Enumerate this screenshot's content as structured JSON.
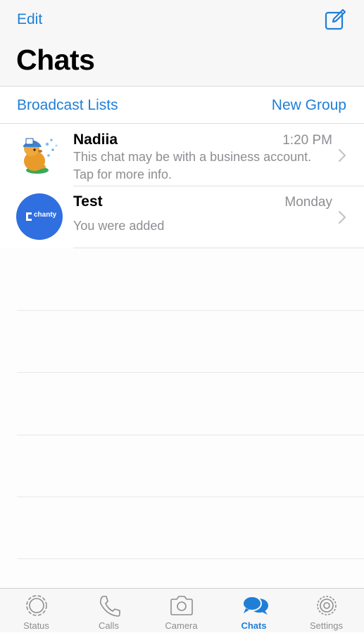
{
  "header": {
    "edit_label": "Edit",
    "title": "Chats",
    "compose_icon": "compose-icon"
  },
  "subbar": {
    "broadcast_label": "Broadcast Lists",
    "new_group_label": "New Group"
  },
  "chats": [
    {
      "name": "Nadiia",
      "time": "1:20 PM",
      "preview": "This chat may be with a business account. Tap for more info.",
      "avatar_icon": "beaver-sticker-avatar"
    },
    {
      "name": "Test",
      "time": "Monday",
      "preview": "You were added",
      "avatar_text": "chanty",
      "avatar_color": "#2f6fe0"
    }
  ],
  "tabs": [
    {
      "label": "Status",
      "icon": "status-icon",
      "active": false
    },
    {
      "label": "Calls",
      "icon": "phone-icon",
      "active": false
    },
    {
      "label": "Camera",
      "icon": "camera-icon",
      "active": false
    },
    {
      "label": "Chats",
      "icon": "chat-bubbles-icon",
      "active": true
    },
    {
      "label": "Settings",
      "icon": "gear-icon",
      "active": false
    }
  ],
  "colors": {
    "accent": "#1f7fd6",
    "secondary_text": "#8e8e93"
  }
}
